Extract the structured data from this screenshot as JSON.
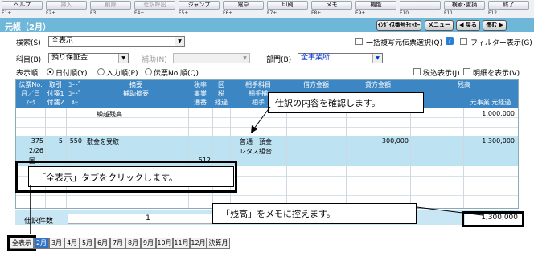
{
  "fkeys": [
    {
      "label": "ヘルプ",
      "key": "F1+",
      "disabled": false
    },
    {
      "label": "挿入",
      "key": "F2+",
      "disabled": true
    },
    {
      "label": "削除",
      "key": "F3",
      "disabled": true
    },
    {
      "label": "仕訳呼出",
      "key": "F4+",
      "disabled": true
    },
    {
      "label": "ジャンプ",
      "key": "F5+",
      "disabled": false
    },
    {
      "label": "電卓",
      "key": "F6+",
      "disabled": false
    },
    {
      "label": "印刷",
      "key": "F7+",
      "disabled": false
    },
    {
      "label": "メモ",
      "key": "F8+",
      "disabled": false
    },
    {
      "label": "機能",
      "key": "F9+",
      "disabled": false
    },
    {
      "label": "",
      "key": "F10",
      "disabled": false
    },
    {
      "label": "検索･置換",
      "key": "F11",
      "disabled": false
    },
    {
      "label": "終了",
      "key": "F12",
      "disabled": false
    }
  ],
  "title": "元帳（2月）",
  "title_buttons": {
    "invoice": "ｲﾝﾎﾞｲｽ番号ﾁｪｯｶｰ",
    "menu": "メニュー",
    "prev": "◀ 戻る",
    "next": "進む ▶"
  },
  "filters": {
    "search_label": "検索(S)",
    "search_value": "全表示",
    "bulk_label": "一括複写元伝票選択(Q)",
    "filter_label": "フィルター表示(G)",
    "account_label": "科目(B)",
    "account_value": "預り保証金",
    "sub_label": "補助(N)",
    "sub_value": "",
    "dept_label": "部門(B)",
    "dept_value": "全事業所",
    "order_label": "表示順",
    "order_options": [
      "日付順(Y)",
      "入力順(P)",
      "伝票No.順(Q)"
    ],
    "tax_label": "税込表示(J)",
    "memo_label": "明細を表示(V)"
  },
  "grid": {
    "h1": [
      "伝票No.",
      "取引",
      "ｺｰﾄﾞ",
      "摘要",
      "税率",
      "区",
      "相手科目",
      "借方金額",
      "貸方金額",
      "残高"
    ],
    "h2": [
      "月／日",
      "付箋1",
      "ｺｰﾄﾞ",
      "補助摘要",
      "事業",
      "税",
      "相手補"
    ],
    "h3": [
      "ﾏｰｸ",
      "付箋2",
      "ﾒﾓ",
      "",
      "通番",
      "経過",
      "相手"
    ],
    "h3_right": "元事業 元経過",
    "carry_label": "繰越残高",
    "carry_balance": "1,000,000",
    "row": {
      "slip": "375",
      "torihiki": "5",
      "code": "550",
      "desc": "敷金を受取",
      "date": "2/26",
      "mark": "国",
      "serial": "512",
      "partner": "普通　預金",
      "partner_sub": "レタス組合",
      "credit": "300,000",
      "balance": "1,300,000"
    }
  },
  "footer": {
    "count_label": "仕訳件数",
    "count": "1",
    "total_balance": "1,300,000"
  },
  "tabs": [
    "全表示",
    "2月",
    "3月",
    "4月",
    "5月",
    "6月",
    "7月",
    "8月",
    "9月",
    "10月",
    "11月",
    "12月",
    "決算月"
  ],
  "callouts": {
    "c1": "仕訳の内容を確認します。",
    "c2": "「全表示」タブをクリックします。",
    "c3": "「残高」をメモに控えます。"
  }
}
